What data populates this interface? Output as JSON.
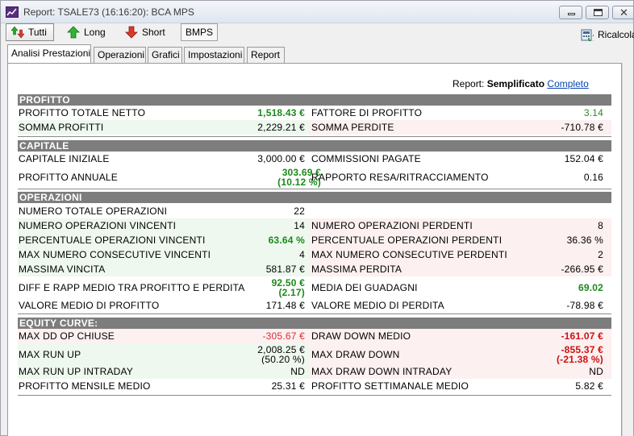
{
  "window": {
    "title": "Report: TSALE73 (16:16:20): BCA MPS"
  },
  "toolbar": {
    "tutti": "Tutti",
    "long": "Long",
    "short": "Short",
    "symbol": "BMPS",
    "ricalcola": "Ricalcola"
  },
  "tabs": [
    "Analisi Prestazioni",
    "Operazioni",
    "Grafici",
    "Impostazioni",
    "Report"
  ],
  "report_mode": {
    "label": "Report:",
    "current": "Semplificato",
    "alternate": "Completo"
  },
  "sections": {
    "profitto": {
      "title": "PROFITTO",
      "rows": [
        {
          "l_label": "PROFITTO TOTALE NETTO",
          "l_value": "1,518.43 €",
          "r_label": "FATTORE DI PROFITTO",
          "r_value": "3.14"
        },
        {
          "l_label": "SOMMA PROFITTI",
          "l_value": "2,229.21 €",
          "r_label": "SOMMA PERDITE",
          "r_value": "-710.78 €"
        }
      ]
    },
    "capitale": {
      "title": "CAPITALE",
      "rows": [
        {
          "l_label": "CAPITALE INIZIALE",
          "l_value": "3,000.00 €",
          "r_label": "COMMISSIONI PAGATE",
          "r_value": "152.04 €"
        },
        {
          "l_label": "PROFITTO ANNUALE",
          "l_value": "303.69 €",
          "l_value2": "(10.12 %)",
          "r_label": "RAPPORTO RESA/RITRACCIAMENTO",
          "r_value": "0.16"
        }
      ]
    },
    "operazioni": {
      "title": "OPERAZIONI",
      "rows": [
        {
          "l_label": "NUMERO TOTALE OPERAZIONI",
          "l_value": "22",
          "r_label": "",
          "r_value": ""
        },
        {
          "l_label": "NUMERO OPERAZIONI VINCENTI",
          "l_value": "14",
          "r_label": "NUMERO OPERAZIONI PERDENTI",
          "r_value": "8"
        },
        {
          "l_label": "PERCENTUALE OPERAZIONI VINCENTI",
          "l_value": "63.64 %",
          "r_label": "PERCENTUALE OPERAZIONI PERDENTI",
          "r_value": "36.36 %"
        },
        {
          "l_label": "MAX NUMERO CONSECUTIVE VINCENTI",
          "l_value": "4",
          "r_label": "MAX NUMERO CONSECUTIVE PERDENTI",
          "r_value": "2"
        },
        {
          "l_label": "MASSIMA VINCITA",
          "l_value": "581.87 €",
          "r_label": "MASSIMA PERDITA",
          "r_value": "-266.95 €"
        },
        {
          "l_label": "DIFF E RAPP MEDIO TRA PROFITTO E PERDITA",
          "l_value": "92.50 €",
          "l_value2": "(2.17)",
          "r_label": "MEDIA DEI GUADAGNI",
          "r_value": "69.02"
        },
        {
          "l_label": "VALORE MEDIO DI PROFITTO",
          "l_value": "171.48 €",
          "r_label": "VALORE MEDIO DI PERDITA",
          "r_value": "-78.98 €"
        }
      ]
    },
    "equity": {
      "title": "EQUITY CURVE:",
      "rows": [
        {
          "l_label": "MAX DD OP CHIUSE",
          "l_value": "-305.67 €",
          "r_label": "DRAW DOWN MEDIO",
          "r_value": "-161.07 €"
        },
        {
          "l_label": "MAX RUN UP",
          "l_value": "2,008.25 €",
          "l_value2": "(50.20 %)",
          "r_label": "MAX DRAW DOWN",
          "r_value": "-855.37 €",
          "r_value2": "(-21.38 %)"
        },
        {
          "l_label": "MAX RUN UP INTRADAY",
          "l_value": "ND",
          "r_label": "MAX DRAW DOWN INTRADAY",
          "r_value": "ND"
        },
        {
          "l_label": "PROFITTO MENSILE MEDIO",
          "l_value": "25.31 €",
          "r_label": "PROFITTO SETTIMANALE MEDIO",
          "r_value": "5.82 €"
        }
      ]
    }
  },
  "colors": {
    "positive": "#1a8a1a",
    "negative": "#cc1111",
    "section_header_bg": "#7d7d7d",
    "profit_row_bg": "#eef8ee",
    "loss_row_bg": "#fcf0f0"
  },
  "icons": {
    "app": "chart-icon",
    "tutti": "up-down-arrows-icon",
    "long": "green-up-arrow-icon",
    "short": "red-down-arrow-icon",
    "ricalcola": "recalculate-icon"
  }
}
